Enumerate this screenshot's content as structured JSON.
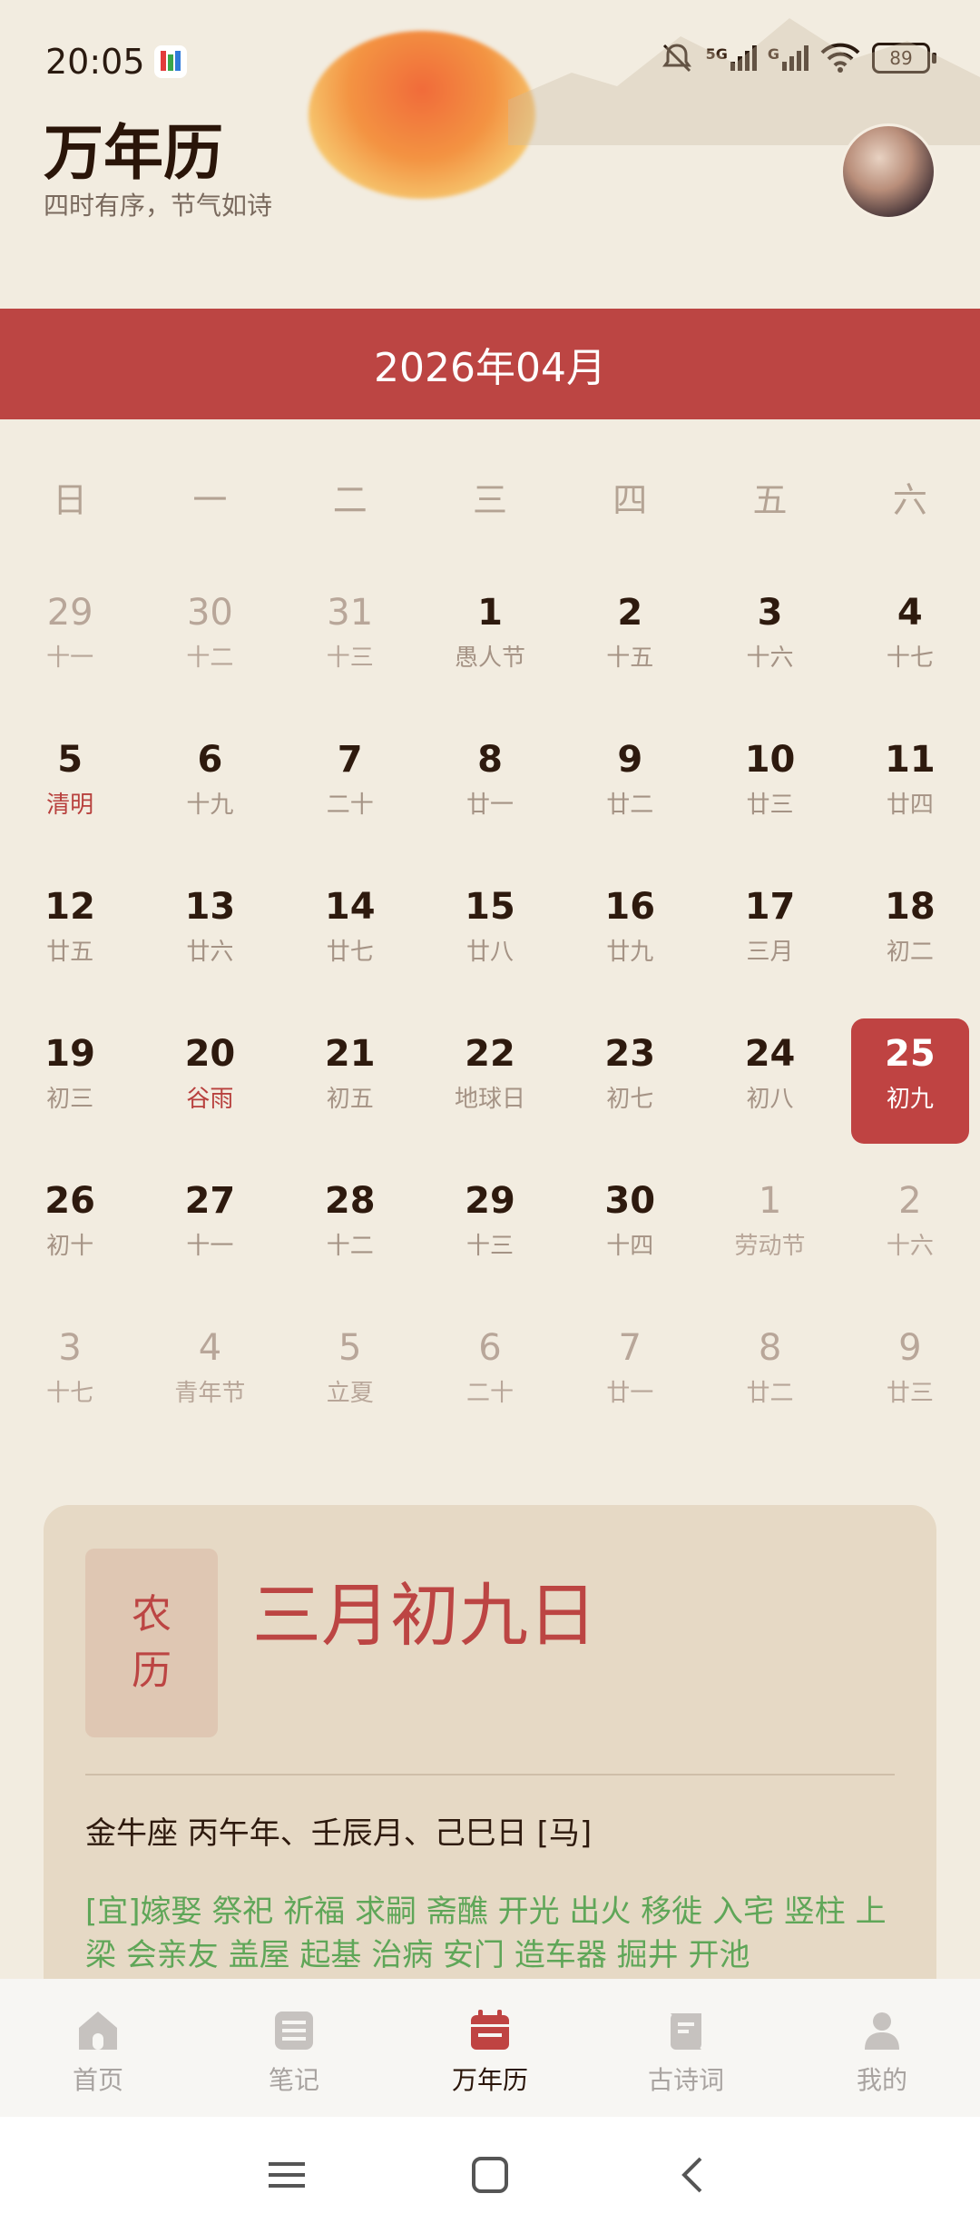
{
  "status": {
    "time": "20:05",
    "battery": "89",
    "network_1": "5G",
    "network_2": "G"
  },
  "header": {
    "title": "万年历",
    "subtitle": "四时有序，节气如诗"
  },
  "month": {
    "label": "2026年04月"
  },
  "weekdays": [
    "日",
    "一",
    "二",
    "三",
    "四",
    "五",
    "六"
  ],
  "weeks": [
    [
      {
        "d": "29",
        "l": "十一",
        "o": true
      },
      {
        "d": "30",
        "l": "十二",
        "o": true
      },
      {
        "d": "31",
        "l": "十三",
        "o": true
      },
      {
        "d": "1",
        "l": "愚人节"
      },
      {
        "d": "2",
        "l": "十五"
      },
      {
        "d": "3",
        "l": "十六"
      },
      {
        "d": "4",
        "l": "十七"
      }
    ],
    [
      {
        "d": "5",
        "l": "清明",
        "t": true
      },
      {
        "d": "6",
        "l": "十九"
      },
      {
        "d": "7",
        "l": "二十"
      },
      {
        "d": "8",
        "l": "廿一"
      },
      {
        "d": "9",
        "l": "廿二"
      },
      {
        "d": "10",
        "l": "廿三"
      },
      {
        "d": "11",
        "l": "廿四"
      }
    ],
    [
      {
        "d": "12",
        "l": "廿五"
      },
      {
        "d": "13",
        "l": "廿六"
      },
      {
        "d": "14",
        "l": "廿七"
      },
      {
        "d": "15",
        "l": "廿八"
      },
      {
        "d": "16",
        "l": "廿九"
      },
      {
        "d": "17",
        "l": "三月"
      },
      {
        "d": "18",
        "l": "初二"
      }
    ],
    [
      {
        "d": "19",
        "l": "初三"
      },
      {
        "d": "20",
        "l": "谷雨",
        "t": true
      },
      {
        "d": "21",
        "l": "初五"
      },
      {
        "d": "22",
        "l": "地球日"
      },
      {
        "d": "23",
        "l": "初七"
      },
      {
        "d": "24",
        "l": "初八"
      },
      {
        "d": "25",
        "l": "初九",
        "s": true
      }
    ],
    [
      {
        "d": "26",
        "l": "初十"
      },
      {
        "d": "27",
        "l": "十一"
      },
      {
        "d": "28",
        "l": "十二"
      },
      {
        "d": "29",
        "l": "十三"
      },
      {
        "d": "30",
        "l": "十四"
      },
      {
        "d": "1",
        "l": "劳动节",
        "o": true
      },
      {
        "d": "2",
        "l": "十六",
        "o": true
      }
    ],
    [
      {
        "d": "3",
        "l": "十七",
        "o": true
      },
      {
        "d": "4",
        "l": "青年节",
        "o": true
      },
      {
        "d": "5",
        "l": "立夏",
        "o": true
      },
      {
        "d": "6",
        "l": "二十",
        "o": true
      },
      {
        "d": "7",
        "l": "廿一",
        "o": true
      },
      {
        "d": "8",
        "l": "廿二",
        "o": true
      },
      {
        "d": "9",
        "l": "廿三",
        "o": true
      }
    ]
  ],
  "detail": {
    "badge_line1": "农",
    "badge_line2": "历",
    "lunar_date": "三月初九日",
    "ganzhi": "金牛座 丙午年、壬辰月、己巳日 [马]",
    "yi": "[宜]嫁娶 祭祀 祈福 求嗣 斋醮 开光 出火 移徙 入宅 竖柱 上梁 会亲友 盖屋 起基 治病 安门 造车器 掘井 开池"
  },
  "nav": [
    {
      "label": "首页",
      "icon": "home-icon"
    },
    {
      "label": "笔记",
      "icon": "notes-icon"
    },
    {
      "label": "万年历",
      "icon": "calendar-icon",
      "active": true
    },
    {
      "label": "古诗词",
      "icon": "book-icon"
    },
    {
      "label": "我的",
      "icon": "profile-icon"
    }
  ],
  "colors": {
    "accent": "#bc4543",
    "yi_green": "#5fa658",
    "background": "#f2ece0"
  }
}
